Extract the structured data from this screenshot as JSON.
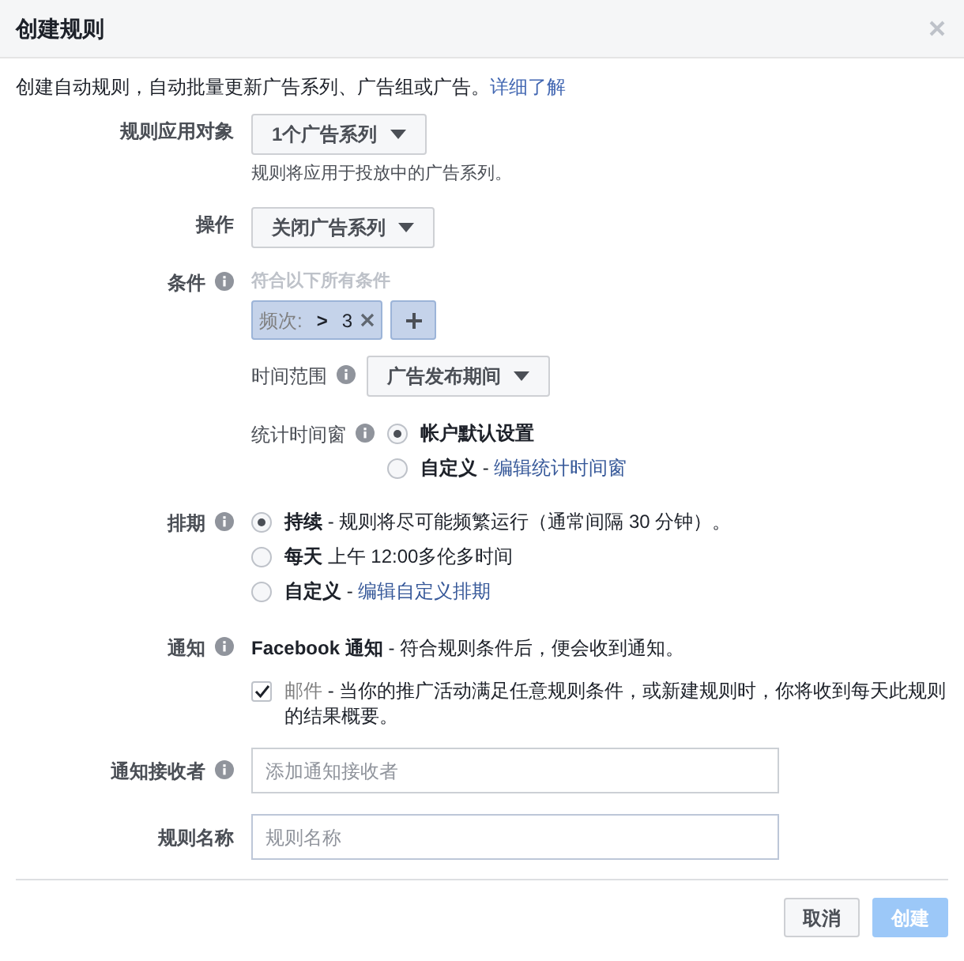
{
  "dialog": {
    "title": "创建规则",
    "intro": "创建自动规则，自动批量更新广告系列、广告组或广告。",
    "intro_link": "详细了解"
  },
  "apply_to": {
    "label": "规则应用对象",
    "value": "1个广告系列",
    "hint": "规则将应用于投放中的广告系列。"
  },
  "action": {
    "label": "操作",
    "value": "关闭广告系列"
  },
  "conditions": {
    "label": "条件",
    "hint": "符合以下所有条件",
    "tags": [
      {
        "name": "频次:",
        "operator": ">",
        "value": "3"
      }
    ]
  },
  "time_range": {
    "label": "时间范围",
    "value": "广告发布期间"
  },
  "attribution": {
    "label": "统计时间窗",
    "options": [
      {
        "label": "帐户默认设置",
        "selected": true
      },
      {
        "label": "自定义",
        "text": "-",
        "link": "编辑统计时间窗",
        "selected": false
      }
    ]
  },
  "schedule": {
    "label": "排期",
    "options": [
      {
        "label": "持续",
        "text": "- 规则将尽可能频繁运行（通常间隔 30 分钟）。",
        "selected": true
      },
      {
        "label": "每天",
        "text": "上午 12:00多伦多时间",
        "selected": false
      },
      {
        "label": "自定义",
        "text": "-",
        "link": "编辑自定义排期",
        "selected": false
      }
    ]
  },
  "notification": {
    "label": "通知",
    "title": "Facebook 通知",
    "text": "- 符合规则条件后，便会收到通知。",
    "email_label": "邮件",
    "email_text": "- 当你的推广活动满足任意规则条件，或新建规则时，你将收到每天此规则的结果概要。",
    "email_checked": true
  },
  "recipients": {
    "label": "通知接收者",
    "placeholder": "添加通知接收者"
  },
  "rule_name": {
    "label": "规则名称",
    "placeholder": "规则名称"
  },
  "buttons": [
    {
      "label": "取消",
      "kind": "secondary",
      "disabled": false
    },
    {
      "label": "创建",
      "kind": "primary",
      "disabled": true
    }
  ]
}
